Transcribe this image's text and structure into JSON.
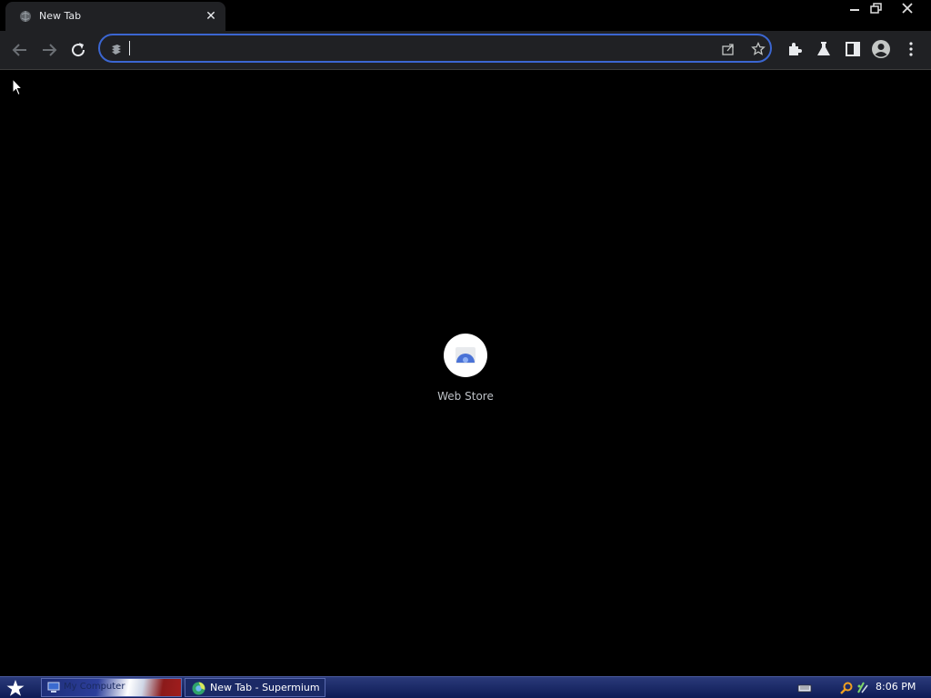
{
  "tab": {
    "title": "New Tab"
  },
  "omnibox": {
    "value": "",
    "placeholder": ""
  },
  "shortcuts": [
    {
      "label": "Web Store"
    }
  ],
  "taskbar": {
    "items": [
      {
        "label": "My Computer"
      },
      {
        "label": "New Tab - Supermium"
      }
    ],
    "clock": "8:06 PM"
  },
  "colors": {
    "accent": "#3b66d1",
    "toolbar": "#202124",
    "background": "#000000"
  }
}
